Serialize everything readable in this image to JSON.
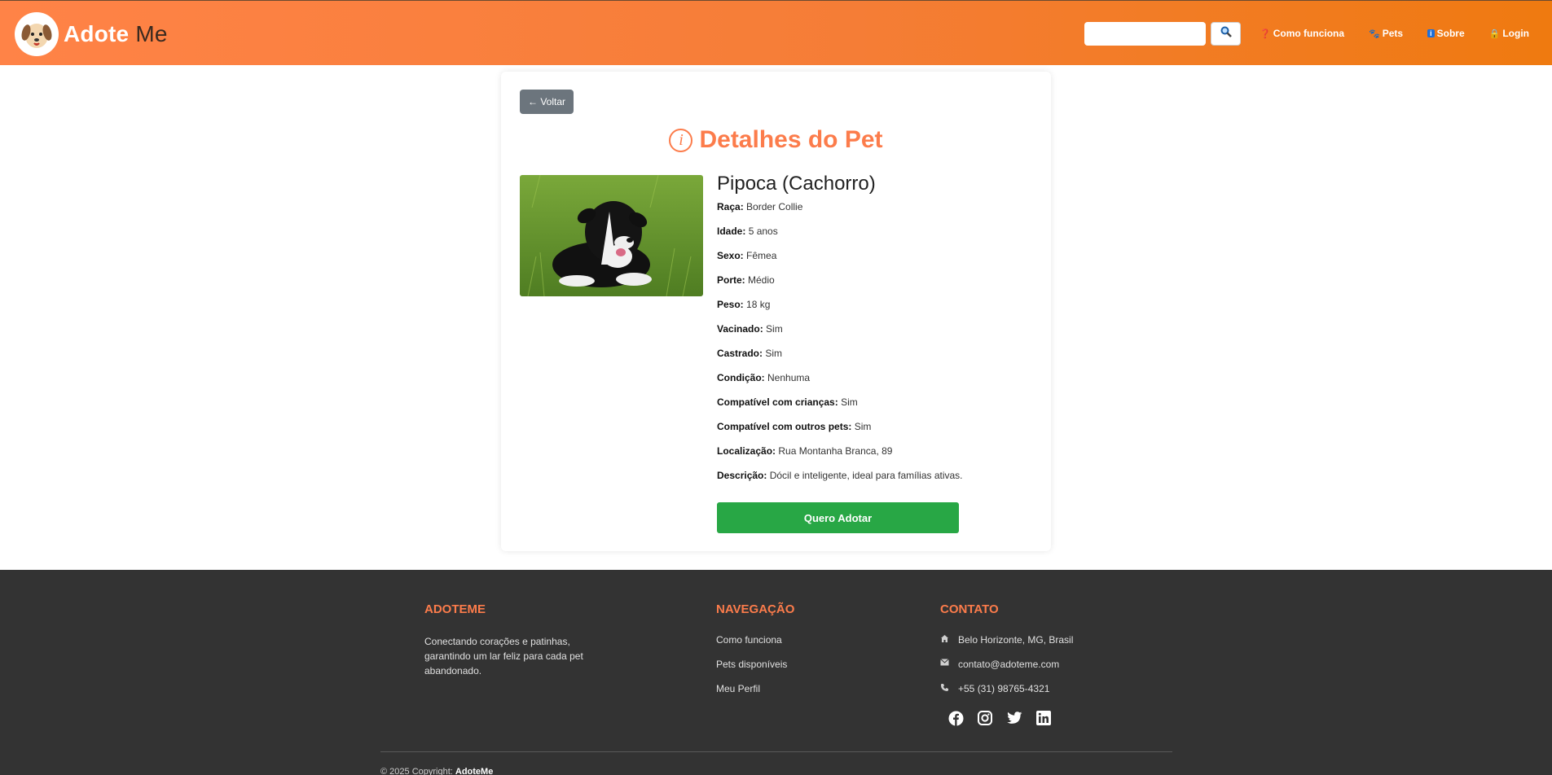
{
  "header": {
    "logo_bold": "Adote",
    "logo_thin": "Me",
    "search_placeholder": "",
    "nav": [
      {
        "icon": "question-icon",
        "label": "Como funciona"
      },
      {
        "icon": "paw-icon",
        "label": "Pets"
      },
      {
        "icon": "info-icon",
        "label": "Sobre"
      },
      {
        "icon": "lock-icon",
        "label": "Login"
      }
    ]
  },
  "card": {
    "back_label": "← Voltar",
    "title": "Detalhes do Pet",
    "pet_name": "Pipoca (Cachorro)",
    "fields": [
      {
        "label": "Raça:",
        "value": "Border Collie"
      },
      {
        "label": "Idade:",
        "value": "5 anos"
      },
      {
        "label": "Sexo:",
        "value": "Fêmea"
      },
      {
        "label": "Porte:",
        "value": "Médio"
      },
      {
        "label": "Peso:",
        "value": "18 kg"
      },
      {
        "label": "Vacinado:",
        "value": "Sim"
      },
      {
        "label": "Castrado:",
        "value": "Sim"
      },
      {
        "label": "Condição:",
        "value": "Nenhuma"
      },
      {
        "label": "Compatível com crianças:",
        "value": "Sim"
      },
      {
        "label": "Compatível com outros pets:",
        "value": "Sim"
      },
      {
        "label": "Localização:",
        "value": "Rua Montanha Branca, 89"
      },
      {
        "label": "Descrição:",
        "value": "Dócil e inteligente, ideal para famílias ativas."
      }
    ],
    "adopt_label": "Quero Adotar"
  },
  "footer": {
    "about_title": "ADOTEME",
    "about_text": "Conectando corações e patinhas, garantindo um lar feliz para cada pet abandonado.",
    "nav_title": "NAVEGAÇÃO",
    "nav_links": [
      "Como funciona",
      "Pets disponíveis",
      "Meu Perfil"
    ],
    "contact_title": "CONTATO",
    "contacts": [
      {
        "icon": "home-icon",
        "text": "Belo Horizonte, MG, Brasil"
      },
      {
        "icon": "envelope-icon",
        "text": "contato@adoteme.com"
      },
      {
        "icon": "phone-icon",
        "text": "+55 (31) 98765-4321"
      }
    ],
    "socials": [
      "facebook-icon",
      "instagram-icon",
      "twitter-icon",
      "linkedin-icon"
    ],
    "copyright_prefix": "© 2025 Copyright:",
    "copyright_brand": "AdoteMe"
  },
  "colors": {
    "accent": "#fc7c4b",
    "adopt": "#28a745",
    "back": "#6c757d",
    "footer_bg": "#333333"
  }
}
